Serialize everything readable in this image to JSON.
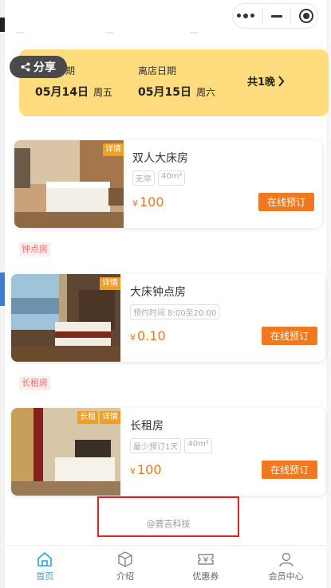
{
  "share": {
    "label": "分享",
    "icon": "share-icon"
  },
  "dates": {
    "checkin_label": "期",
    "checkin_date": "05月14日",
    "checkin_weekday": "周五",
    "checkout_label": "离店日期",
    "checkout_date": "05月15日",
    "checkout_weekday": "周六",
    "nights": "共1晚"
  },
  "rooms": [
    {
      "badge": "详情",
      "name": "双人大床房",
      "tags": [
        "无早",
        "40m²"
      ],
      "price_symbol": "¥",
      "price": "100",
      "button": "在线预订"
    },
    {
      "badge": "详情",
      "name": "大床钟点房",
      "tags": [
        "预约时间 8:00至20:00"
      ],
      "price_symbol": "¥",
      "price": "0.10",
      "button": "在线预订"
    },
    {
      "badge_extra": "长租",
      "badge": "详情",
      "name": "长租房",
      "tags": [
        "最少预订1天",
        "40m²"
      ],
      "price_symbol": "¥",
      "price": "100",
      "button": "在线预订"
    }
  ],
  "sections": {
    "hourly": "钟点房",
    "longterm": "长租房"
  },
  "credit": "@普吉科技",
  "tabbar": [
    {
      "label": "首页",
      "icon": "home-icon",
      "active": true
    },
    {
      "label": "介绍",
      "icon": "cube-icon",
      "active": false
    },
    {
      "label": "优惠券",
      "icon": "coupon-icon",
      "active": false
    },
    {
      "label": "会员中心",
      "icon": "user-icon",
      "active": false
    }
  ],
  "colors": {
    "accent": "#f0781f",
    "date_card": "#ffdc7d",
    "tab_active": "#29a3e0",
    "badge": "#f0a020"
  }
}
